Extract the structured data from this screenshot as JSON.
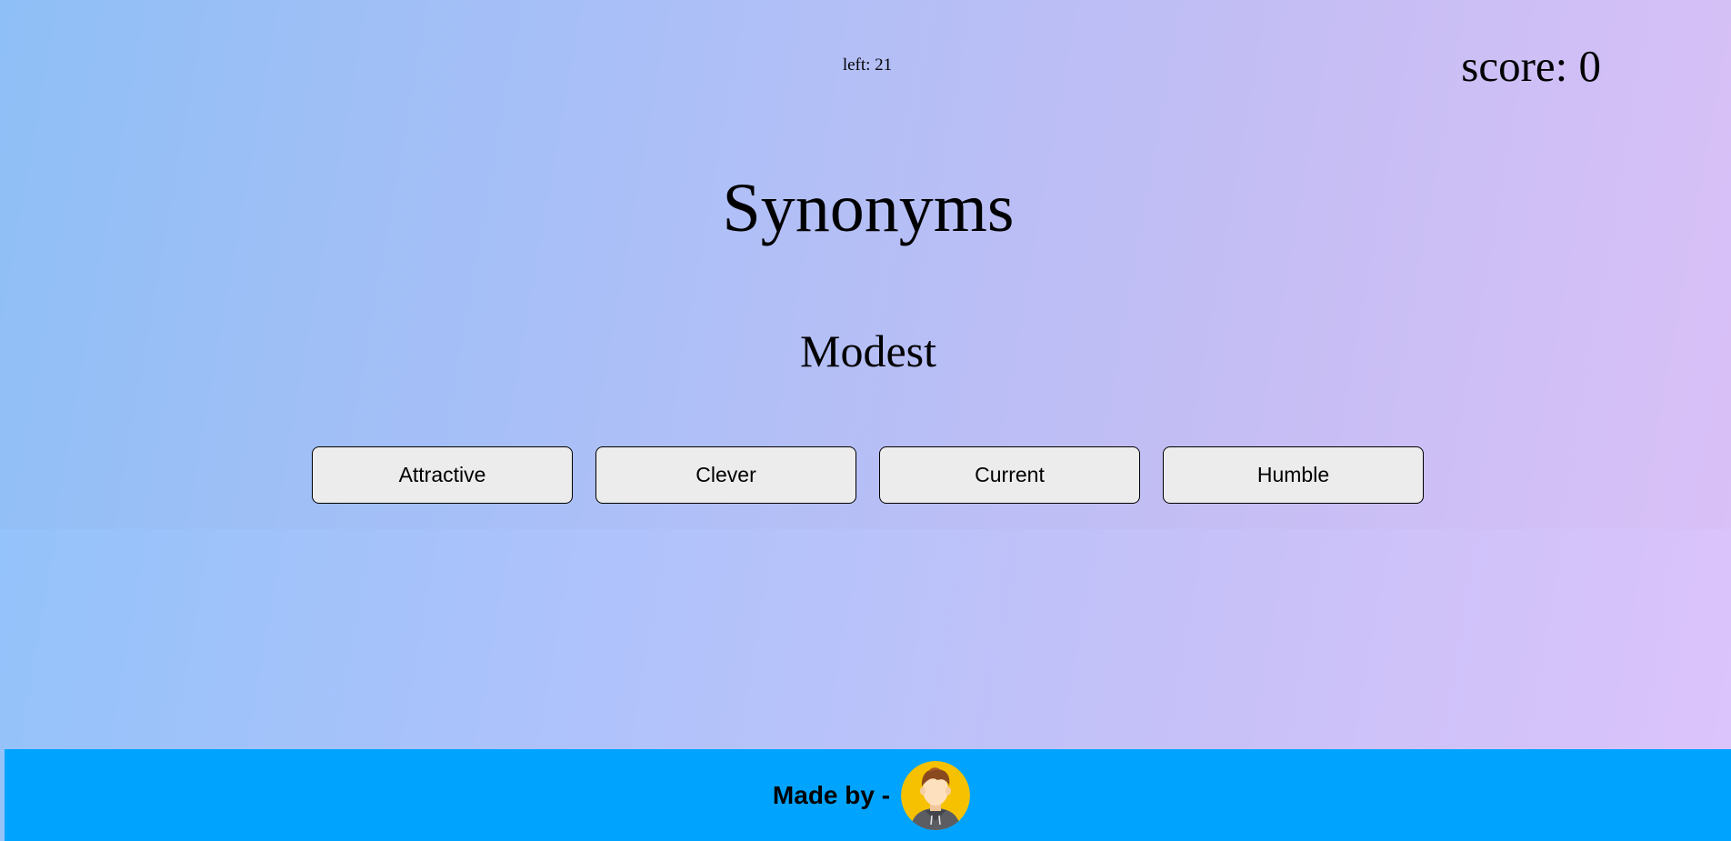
{
  "game": {
    "left_label": "left: 21",
    "score_label": "score: 0",
    "title": "Synonyms",
    "word": "Modest",
    "options": [
      "Attractive",
      "Clever",
      "Current",
      "Humble"
    ]
  },
  "footer": {
    "made_by": "Made by -",
    "avatar_icon": "avatar-icon",
    "background": "#00a4ff"
  },
  "colors": {
    "gradient_start": "#90c2fa",
    "gradient_end": "#dcc3fb",
    "button_bg": "#f0f0f0",
    "avatar_bg": "#f5c100"
  }
}
